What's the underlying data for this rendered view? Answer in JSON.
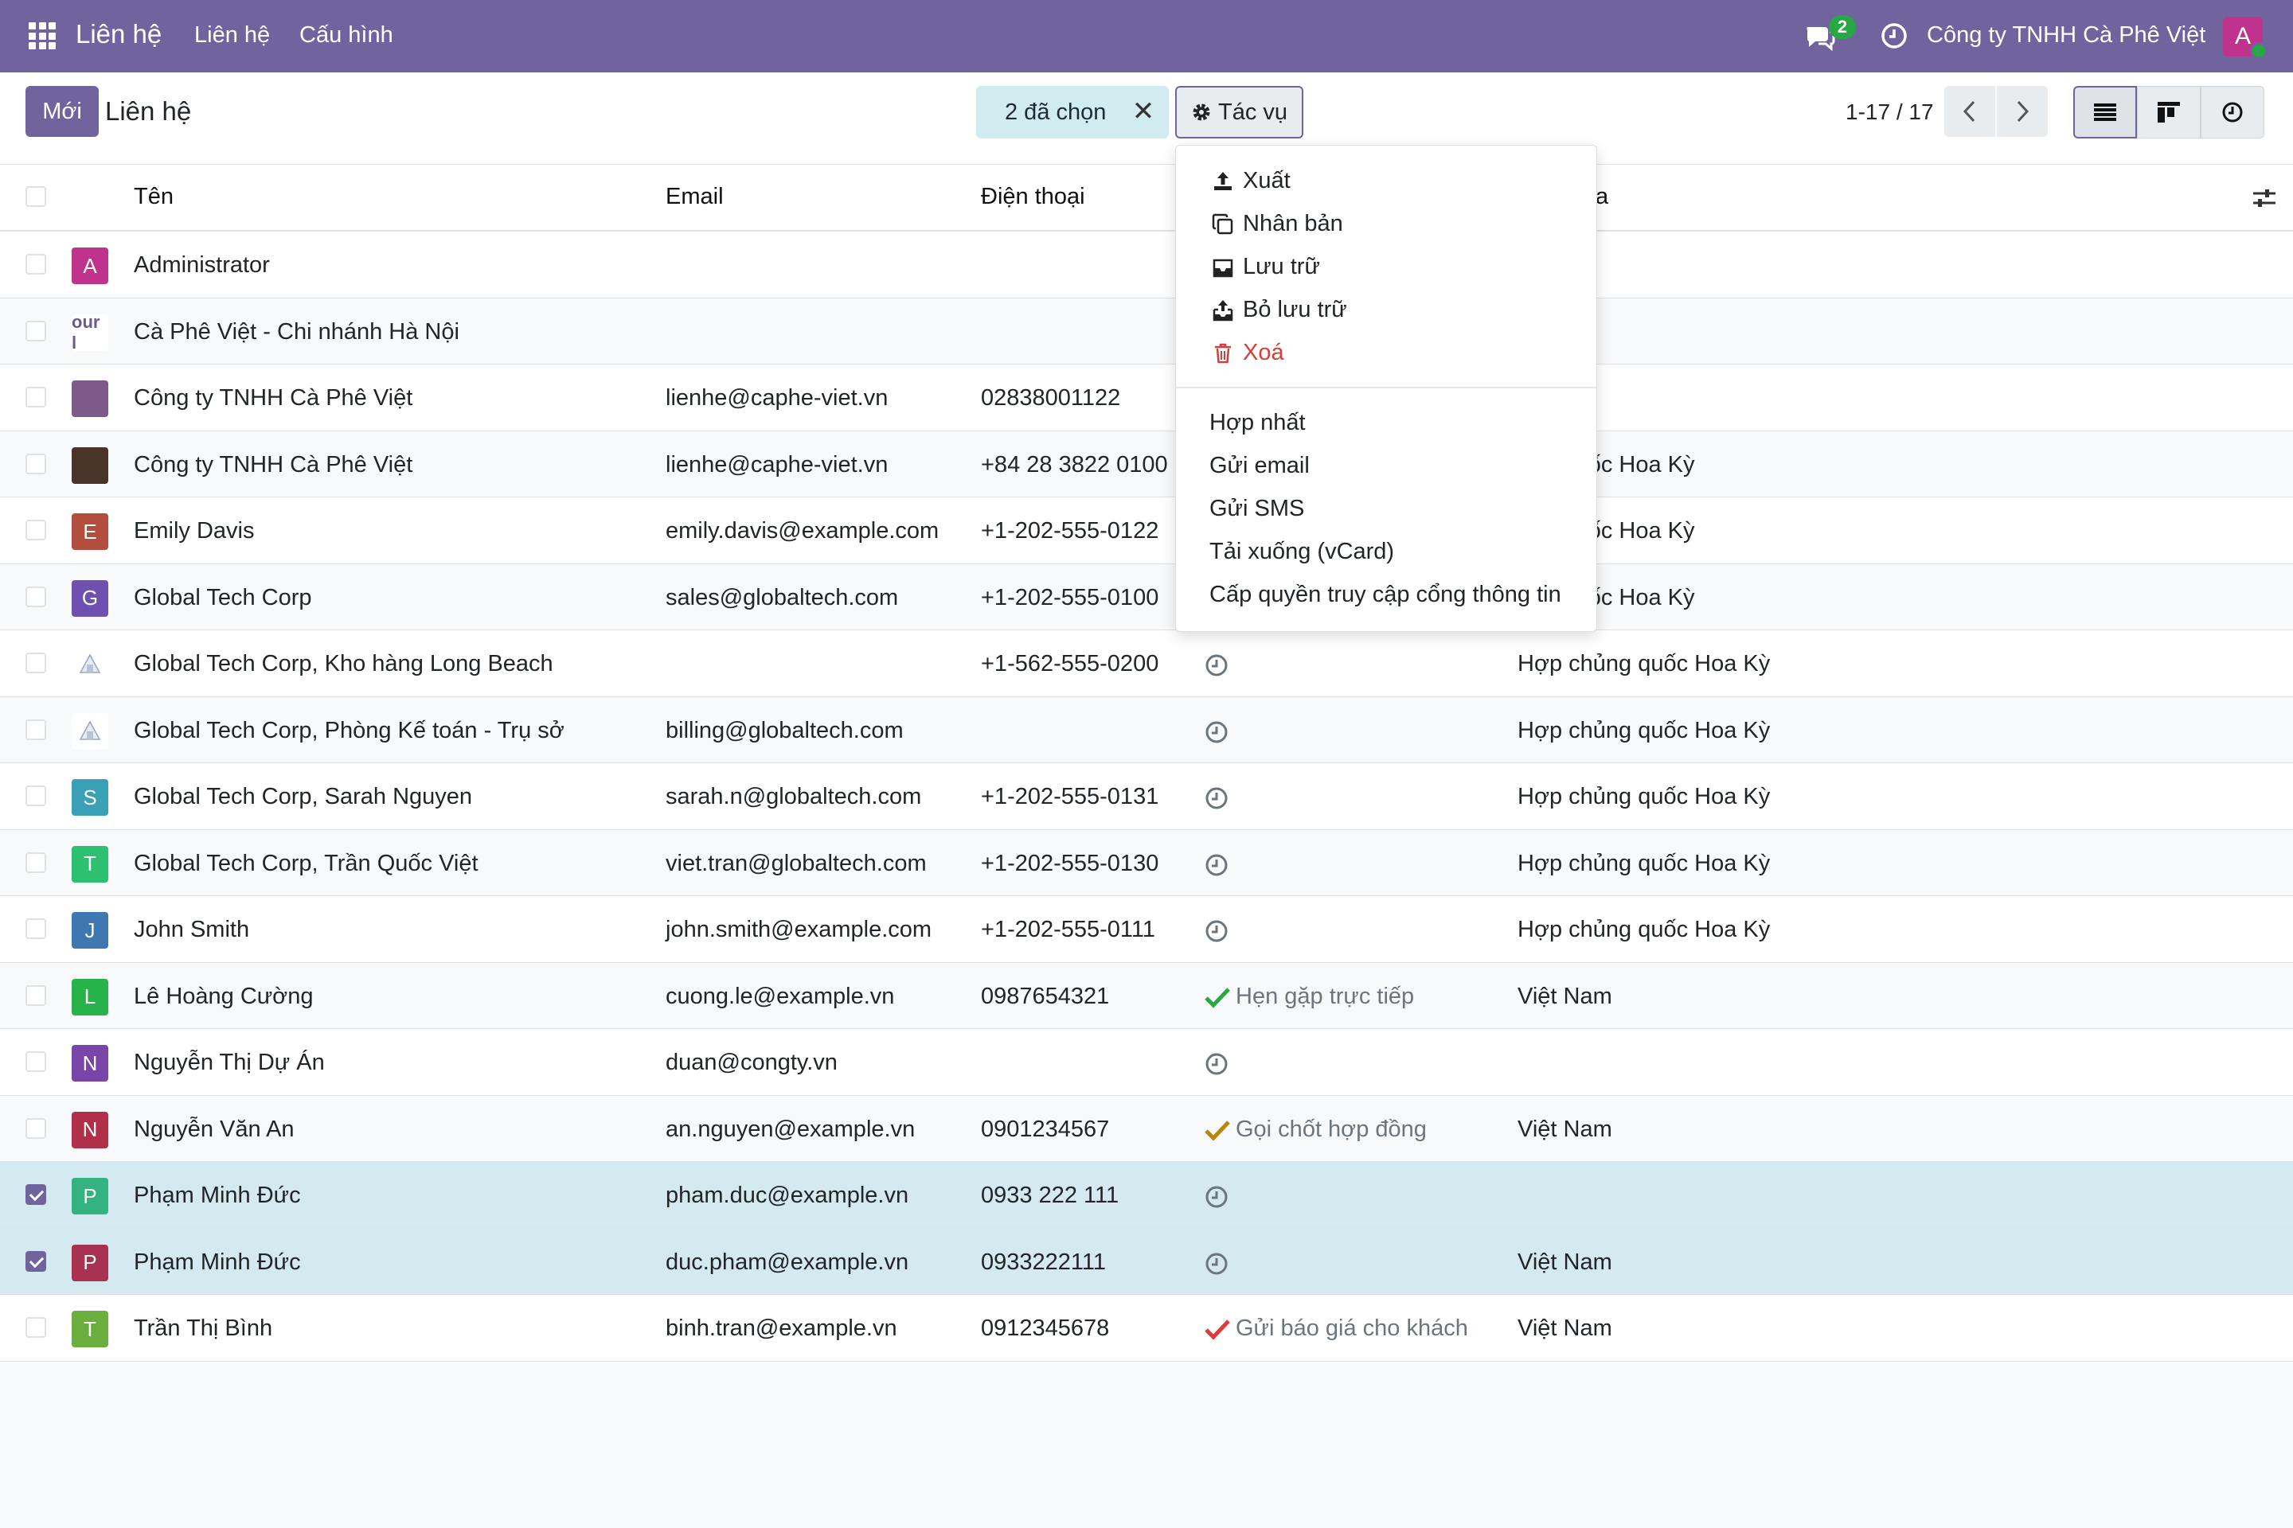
{
  "navbar": {
    "brand": "Liên hệ",
    "menu": [
      "Liên hệ",
      "Cấu hình"
    ],
    "chat_badge": "2",
    "company": "Công ty TNHH Cà Phê Việt",
    "avatar_letter": "A"
  },
  "control_panel": {
    "new_button": "Mới",
    "title": "Liên hệ",
    "selection_text": "2 đã chọn",
    "selection_close": "✕",
    "actions_button": "Tác vụ",
    "pager": "1-17 / 17"
  },
  "columns": {
    "name": "Tên",
    "email": "Email",
    "phone": "Điện thoại",
    "country_partial": "a"
  },
  "rows": [
    {
      "avatar": "A",
      "avatar_color": "#c0338d",
      "name": "Administrator",
      "email": "",
      "phone": "",
      "activity": "",
      "activity_type": "none",
      "country": "",
      "selected": false
    },
    {
      "avatar": "our l",
      "avatar_color": "#ffffff",
      "name": "Cà Phê Việt - Chi nhánh Hà Nội",
      "email": "",
      "phone": "",
      "activity": "",
      "activity_type": "none",
      "country": "",
      "selected": false
    },
    {
      "avatar": "",
      "avatar_color": "#7c5b8a",
      "name": "Công ty TNHH Cà Phê Việt",
      "email": "lienhe@caphe-viet.vn",
      "phone": "02838001122",
      "activity": "",
      "activity_type": "none",
      "country": "m",
      "selected": false
    },
    {
      "avatar": "",
      "avatar_color": "#4a3328",
      "name": "Công ty TNHH Cà Phê Việt",
      "email": "lienhe@caphe-viet.vn",
      "phone": "+84 28 3822 0100",
      "activity": "",
      "activity_type": "none",
      "country": "ủng quốc Hoa Kỳ",
      "selected": false
    },
    {
      "avatar": "E",
      "avatar_color": "#b34d3e",
      "name": "Emily Davis",
      "email": "emily.davis@example.com",
      "phone": "+1-202-555-0122",
      "activity": "",
      "activity_type": "none",
      "country": "ủng quốc Hoa Kỳ",
      "selected": false
    },
    {
      "avatar": "G",
      "avatar_color": "#6f4fb0",
      "name": "Global Tech Corp",
      "email": "sales@globaltech.com",
      "phone": "+1-202-555-0100",
      "activity": "",
      "activity_type": "none",
      "country": "ủng quốc Hoa Kỳ",
      "selected": false
    },
    {
      "avatar": "",
      "avatar_color": "#ffffff",
      "name": "Global Tech Corp, Kho hàng Long Beach",
      "email": "",
      "phone": "+1-562-555-0200",
      "activity": "",
      "activity_type": "clock",
      "country": "Hợp chủng quốc Hoa Kỳ",
      "selected": false
    },
    {
      "avatar": "",
      "avatar_color": "#ffffff",
      "name": "Global Tech Corp, Phòng Kế toán - Trụ sở",
      "email": "billing@globaltech.com",
      "phone": "",
      "activity": "",
      "activity_type": "clock",
      "country": "Hợp chủng quốc Hoa Kỳ",
      "selected": false
    },
    {
      "avatar": "S",
      "avatar_color": "#3aa0b5",
      "name": "Global Tech Corp, Sarah Nguyen",
      "email": "sarah.n@globaltech.com",
      "phone": "+1-202-555-0131",
      "activity": "",
      "activity_type": "clock",
      "country": "Hợp chủng quốc Hoa Kỳ",
      "selected": false
    },
    {
      "avatar": "T",
      "avatar_color": "#2fbf71",
      "name": "Global Tech Corp, Trần Quốc Việt",
      "email": "viet.tran@globaltech.com",
      "phone": "+1-202-555-0130",
      "activity": "",
      "activity_type": "clock",
      "country": "Hợp chủng quốc Hoa Kỳ",
      "selected": false
    },
    {
      "avatar": "J",
      "avatar_color": "#3f78b0",
      "name": "John Smith",
      "email": "john.smith@example.com",
      "phone": "+1-202-555-0111",
      "activity": "",
      "activity_type": "clock",
      "country": "Hợp chủng quốc Hoa Kỳ",
      "selected": false
    },
    {
      "avatar": "L",
      "avatar_color": "#27b34a",
      "name": "Lê Hoàng Cường",
      "email": "cuong.le@example.vn",
      "phone": "0987654321",
      "activity": "Hẹn gặp trực tiếp",
      "activity_type": "check-green",
      "country": "Việt Nam",
      "selected": false
    },
    {
      "avatar": "N",
      "avatar_color": "#7a45a8",
      "name": "Nguyễn Thị Dự Án",
      "email": "duan@congty.vn",
      "phone": "",
      "activity": "",
      "activity_type": "clock",
      "country": "",
      "selected": false
    },
    {
      "avatar": "N",
      "avatar_color": "#b0304a",
      "name": "Nguyễn Văn An",
      "email": "an.nguyen@example.vn",
      "phone": "0901234567",
      "activity": "Gọi chốt hợp đồng",
      "activity_type": "check-orange",
      "country": "Việt Nam",
      "selected": false
    },
    {
      "avatar": "P",
      "avatar_color": "#32b37f",
      "name": "Phạm Minh Đức",
      "email": "pham.duc@example.vn",
      "phone": "0933 222 111",
      "activity": "",
      "activity_type": "clock",
      "country": "",
      "selected": true
    },
    {
      "avatar": "P",
      "avatar_color": "#a8324f",
      "name": "Phạm Minh Đức",
      "email": "duc.pham@example.vn",
      "phone": "0933222111",
      "activity": "",
      "activity_type": "clock",
      "country": "Việt Nam",
      "selected": true
    },
    {
      "avatar": "T",
      "avatar_color": "#6aae3e",
      "name": "Trần Thị Bình",
      "email": "binh.tran@example.vn",
      "phone": "0912345678",
      "activity": "Gửi báo giá cho khách",
      "activity_type": "check-red",
      "country": "Việt Nam",
      "selected": false
    }
  ],
  "dropdown": {
    "export": "Xuất",
    "duplicate": "Nhân bản",
    "archive": "Lưu trữ",
    "unarchive": "Bỏ lưu trữ",
    "delete": "Xoá",
    "merge": "Hợp nhất",
    "send_email": "Gửi email",
    "send_sms": "Gửi SMS",
    "download_vcard": "Tải xuống (vCard)",
    "grant_portal": "Cấp quyền truy cập cổng thông tin"
  },
  "colors": {
    "brand": "#71639e",
    "selected_row": "#d4eaf0",
    "danger": "#d23f3a"
  }
}
